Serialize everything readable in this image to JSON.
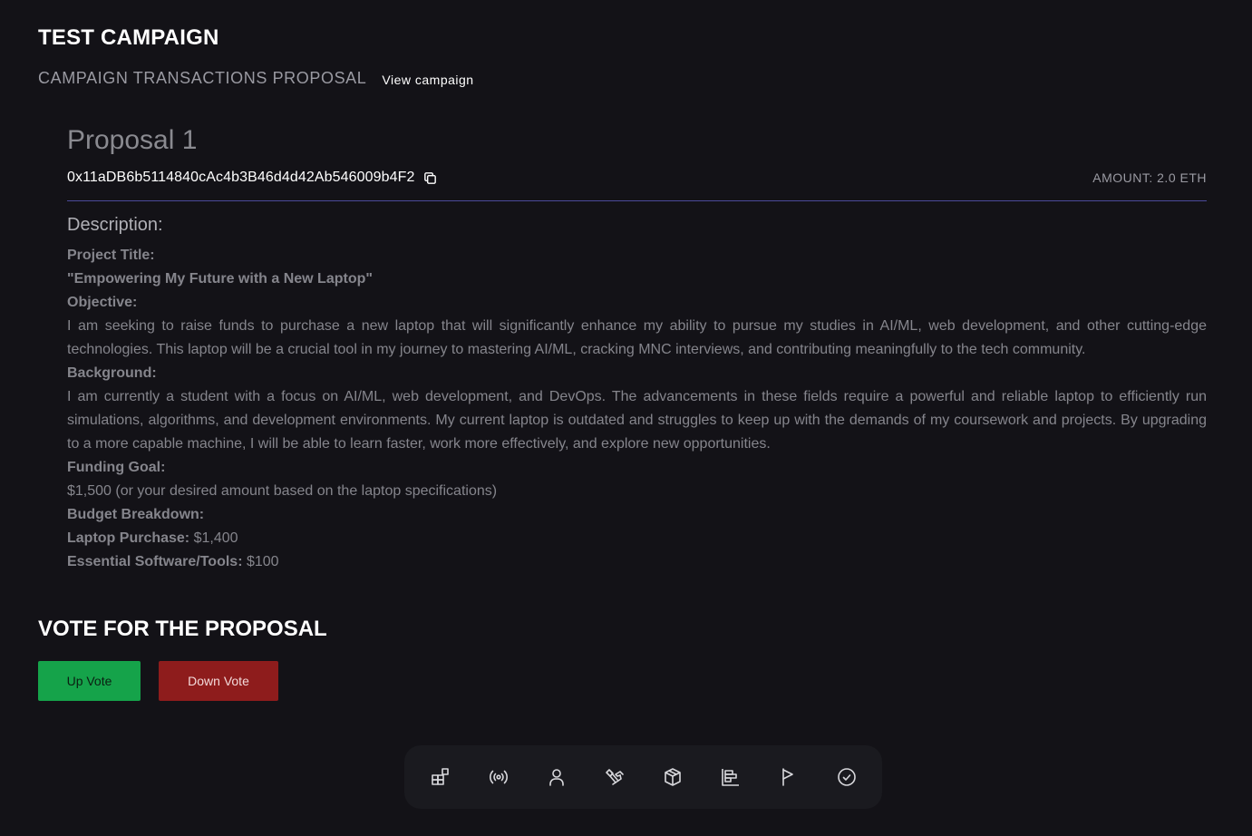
{
  "header": {
    "title": "TEST CAMPAIGN",
    "subtitle": "CAMPAIGN TRANSACTIONS PROPOSAL",
    "view_campaign": "View campaign"
  },
  "proposal": {
    "title": "Proposal 1",
    "address": "0x11aDB6b5114840cAc4b3B46d4d42Ab546009b4F2",
    "amount": "AMOUNT: 2.0 ETH",
    "description_heading": "Description:",
    "project_title_label": "Project Title:",
    "project_title": "\"Empowering My Future with a New Laptop\"",
    "objective_label": "Objective:",
    "objective": "I am seeking to raise funds to purchase a new laptop that will significantly enhance my ability to pursue my studies in AI/ML, web development, and other cutting-edge technologies. This laptop will be a crucial tool in my journey to mastering AI/ML, cracking MNC interviews, and contributing meaningfully to the tech community.",
    "background_label": "Background:",
    "background": "I am currently a student with a focus on AI/ML, web development, and DevOps. The advancements in these fields require a powerful and reliable laptop to efficiently run simulations, algorithms, and development environments. My current laptop is outdated and struggles to keep up with the demands of my coursework and projects. By upgrading to a more capable machine, I will be able to learn faster, work more effectively, and explore new opportunities.",
    "funding_goal_label": "Funding Goal:",
    "funding_goal": "$1,500 (or your desired amount based on the laptop specifications)",
    "budget_label": "Budget Breakdown:",
    "budget_items": [
      {
        "label": "Laptop Purchase:",
        "value": "$1,400"
      },
      {
        "label": "Essential Software/Tools:",
        "value": "$100"
      }
    ]
  },
  "vote": {
    "heading": "VOTE FOR THE PROPOSAL",
    "up_label": "Up Vote",
    "down_label": "Down Vote",
    "up_color": "#15a34a",
    "down_color": "#8e1c1c"
  },
  "dock": {
    "icons": [
      "dashboard-icon",
      "broadcast-icon",
      "user-icon",
      "handshake-icon",
      "package-icon",
      "chart-bars-icon",
      "flag-icon",
      "check-circle-icon"
    ]
  }
}
